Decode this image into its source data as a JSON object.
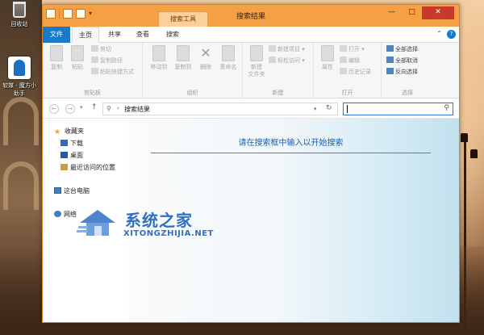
{
  "desktop": {
    "recycle_label": "回收站",
    "app_label_1": "软媒 · 魔方小",
    "app_label_2": "助手"
  },
  "window": {
    "title": "搜索结果",
    "context_tab": "搜索工具",
    "controls": {
      "minimize": "—",
      "maximize": "□",
      "close": "✕"
    }
  },
  "ribbon_tabs": {
    "file": "文件",
    "home": "主页",
    "share": "共享",
    "view": "查看",
    "search": "搜索"
  },
  "ribbon": {
    "clipboard": {
      "label": "剪贴板",
      "copy": "复制",
      "paste": "粘贴",
      "cut": "剪切",
      "copy_path": "复制路径",
      "paste_shortcut": "粘贴快捷方式"
    },
    "organize": {
      "label": "组织",
      "move_to": "移动到",
      "copy_to": "复制到",
      "delete": "删除",
      "rename": "重命名"
    },
    "new": {
      "label": "新建",
      "new_folder_1": "新建",
      "new_folder_2": "文件夹",
      "new_item": "新建项目",
      "easy_access": "轻松访问"
    },
    "open": {
      "label": "打开",
      "properties": "属性",
      "open": "打开",
      "edit": "编辑",
      "history": "历史记录"
    },
    "select": {
      "label": "选择",
      "select_all": "全部选择",
      "select_none": "全部取消",
      "invert": "反向选择"
    }
  },
  "address": {
    "path": "搜索结果"
  },
  "navpane": {
    "favorites": "收藏夹",
    "downloads": "下载",
    "desktop": "桌面",
    "recent": "最近访问的位置",
    "this_pc": "这台电脑",
    "network": "网络"
  },
  "content": {
    "hint": "请在搜索框中输入以开始搜索"
  },
  "watermark": {
    "cn": "系统之家",
    "en": "XITONGZHIJIA.NET"
  }
}
